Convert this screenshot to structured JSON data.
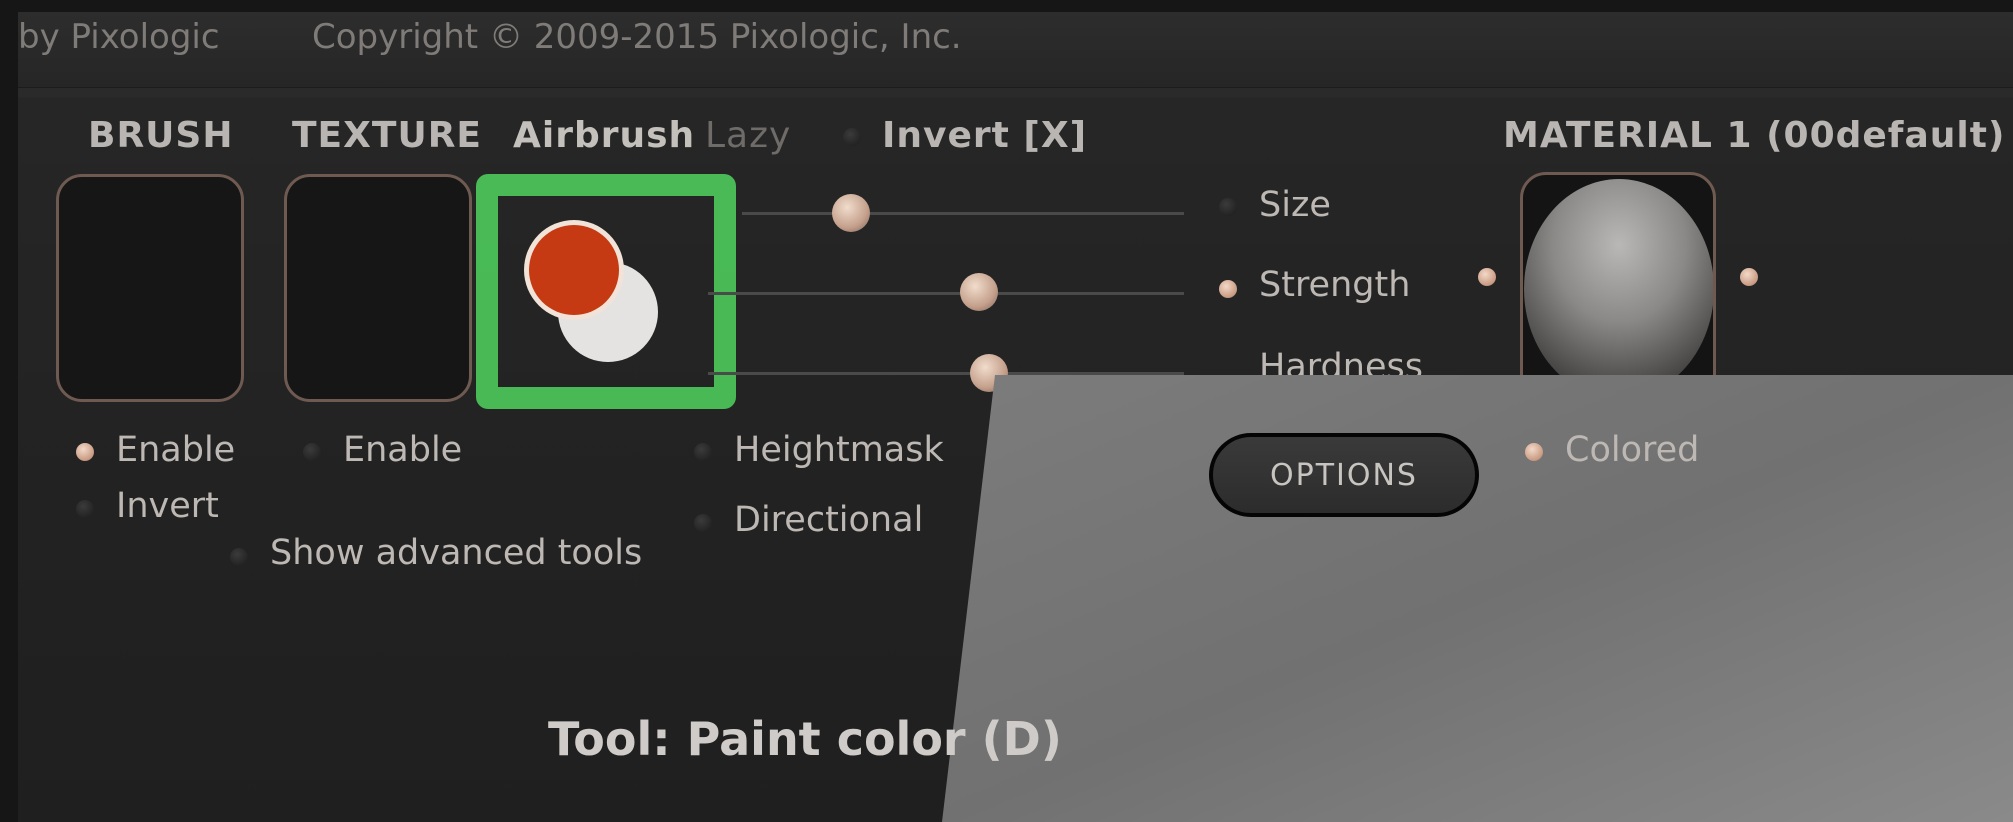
{
  "header_bar": {
    "by_text": "by Pixologic",
    "copyright": "Copyright © 2009-2015 Pixologic, Inc."
  },
  "columns": {
    "brush": "BRUSH",
    "texture": "TEXTURE",
    "airbrush": "Airbrush",
    "lazy": "Lazy",
    "invert_x": "Invert [X]",
    "material": "MATERIAL 1 (00default)"
  },
  "sliders": {
    "size_label": "Size",
    "strength_label": "Strength",
    "hardness_label": "Hardness"
  },
  "options_button": "OPTIONS",
  "brush_opts": {
    "enable": "Enable",
    "invert": "Invert"
  },
  "texture_opts": {
    "enable": "Enable",
    "show_advanced": "Show advanced tools"
  },
  "airbrush_opts": {
    "heightmask": "Heightmask",
    "directional": "Directional"
  },
  "material_opts": {
    "colored": "Colored"
  },
  "tool_status": "Tool: Paint color (D)",
  "colors": {
    "highlight_green": "#4cc75a",
    "paint_red": "#c53a12"
  },
  "icons": {
    "airbrush_swatch": "paint-color-swatch-icon",
    "material_sphere": "material-sphere-icon"
  }
}
